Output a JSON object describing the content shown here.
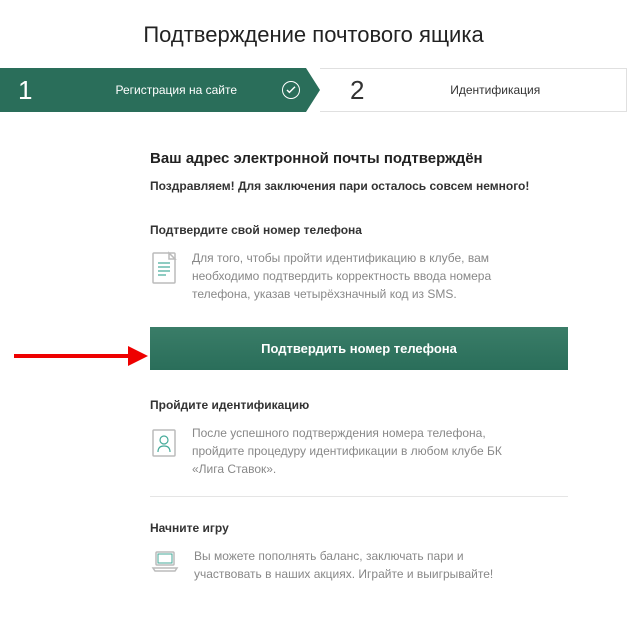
{
  "page": {
    "title": "Подтверждение почтового ящика"
  },
  "steps": {
    "step1": {
      "num": "1",
      "label": "Регистрация на сайте"
    },
    "step2": {
      "num": "2",
      "label": "Идентификация"
    }
  },
  "main": {
    "heading": "Ваш адрес электронной почты подтверждён",
    "subheading": "Поздравляем! Для заключения пари осталось совсем немного!"
  },
  "sections": {
    "phone": {
      "title": "Подтвердите свой номер телефона",
      "text": "Для того, чтобы пройти идентификацию в клубе, вам необходимо подтвердить корректность ввода номера телефона, указав четырёхзначный код из SMS."
    },
    "identify": {
      "title": "Пройдите идентификацию",
      "text": "После успешного подтверждения номера телефона, пройдите процедуру идентификации в любом клубе БК «Лига Ставок»."
    },
    "play": {
      "title": "Начните игру",
      "text": "Вы можете пополнять баланс, заключать пари и участвовать в наших акциях. Играйте и выигрывайте!"
    }
  },
  "cta": {
    "confirm_phone": "Подтвердить номер телефона"
  },
  "colors": {
    "brand": "#2a6e5a",
    "muted": "#888"
  }
}
